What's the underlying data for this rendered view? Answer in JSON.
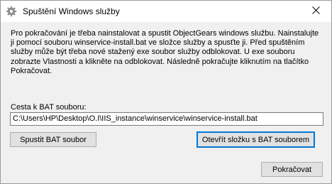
{
  "window": {
    "title": "Spuštění Windows služby",
    "close_icon": "close-icon",
    "app_icon": "gear-app-icon"
  },
  "main": {
    "info_text": "Pro pokračování je třeba nainstalovat a spustit ObjectGears windows službu. Nainstalujte ji pomocí souboru winservice-install.bat ve složce služby a spusťte ji. Před spuštěním služby může být třeba nové stažený exe soubor služby odblokovat. U exe souboru zobrazte Vlastnosti a klikněte na odblokovat. Následně pokračujte kliknutím na tlačítko Pokračovat.",
    "path_label": "Cesta k BAT souboru:",
    "path_value": "C:\\Users\\HP\\Desktop\\O.I\\IIS_instance\\winservice\\winservice-install.bat"
  },
  "buttons": {
    "run_bat": "Spustit BAT soubor",
    "open_folder": "Otevřít složku s BAT souborem",
    "continue": "Pokračovat"
  },
  "colors": {
    "dialog_background": "#f0f0f0",
    "titlebar_background": "#ffffff",
    "button_background": "#e1e1e1",
    "focus_border": "#0078d7"
  }
}
